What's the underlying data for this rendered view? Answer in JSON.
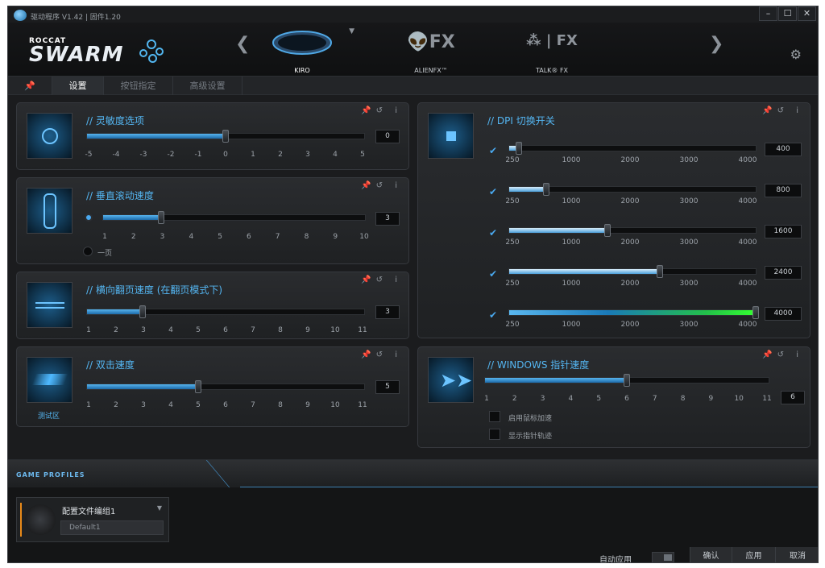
{
  "app": {
    "version_text": "驱动程序 V1.42 | 固件1.20",
    "brand_small": "ROCCAT",
    "brand_big": "SWARM"
  },
  "devices": [
    {
      "label": "KIRO"
    },
    {
      "label": "ALIENFX™"
    },
    {
      "label": "TALK® FX"
    }
  ],
  "tabs": [
    {
      "label": "设置"
    },
    {
      "label": "按钮指定"
    },
    {
      "label": "高级设置"
    }
  ],
  "sensitivity": {
    "title": "// 灵敏度选项",
    "value": "0",
    "level": 0.5,
    "ticks": [
      "-5",
      "-4",
      "-3",
      "-2",
      "-1",
      "0",
      "1",
      "2",
      "3",
      "4",
      "5"
    ]
  },
  "vscroll": {
    "title": "// 垂直滚动速度",
    "value": "3",
    "level": 0.222,
    "ticks": [
      "1",
      "2",
      "3",
      "4",
      "5",
      "6",
      "7",
      "8",
      "9",
      "10"
    ],
    "page_label": "一页"
  },
  "hscroll": {
    "title": "// 横向翻页速度 (在翻页模式下)",
    "value": "3",
    "level": 0.2,
    "ticks": [
      "1",
      "2",
      "3",
      "4",
      "5",
      "6",
      "7",
      "8",
      "9",
      "10",
      "11"
    ]
  },
  "dblclick": {
    "title": "// 双击速度",
    "value": "5",
    "level": 0.4,
    "ticks": [
      "1",
      "2",
      "3",
      "4",
      "5",
      "6",
      "7",
      "8",
      "9",
      "10",
      "11"
    ],
    "test_label": "测试区"
  },
  "dpi": {
    "title": "// DPI 切换开关",
    "ticks": [
      "250",
      "1000",
      "2000",
      "3000",
      "4000"
    ],
    "levels": [
      {
        "value": "400",
        "level": 0.04
      },
      {
        "value": "800",
        "level": 0.15
      },
      {
        "value": "1600",
        "level": 0.4
      },
      {
        "value": "2400",
        "level": 0.61
      },
      {
        "value": "4000",
        "level": 1.0
      }
    ]
  },
  "pointer": {
    "title": "// WINDOWS 指针速度",
    "value": "6",
    "level": 0.5,
    "ticks": [
      "1",
      "2",
      "3",
      "4",
      "5",
      "6",
      "7",
      "8",
      "9",
      "10",
      "11"
    ],
    "accel_label": "启用鼠标加速",
    "trail_label": "显示指针轨迹"
  },
  "game_profiles": {
    "title": "GAME PROFILES",
    "profile_name": "配置文件编组1",
    "profile_value": "Default1"
  },
  "footer": {
    "auto_apply": "自动应用",
    "ok": "确认",
    "apply": "应用",
    "cancel": "取消"
  }
}
